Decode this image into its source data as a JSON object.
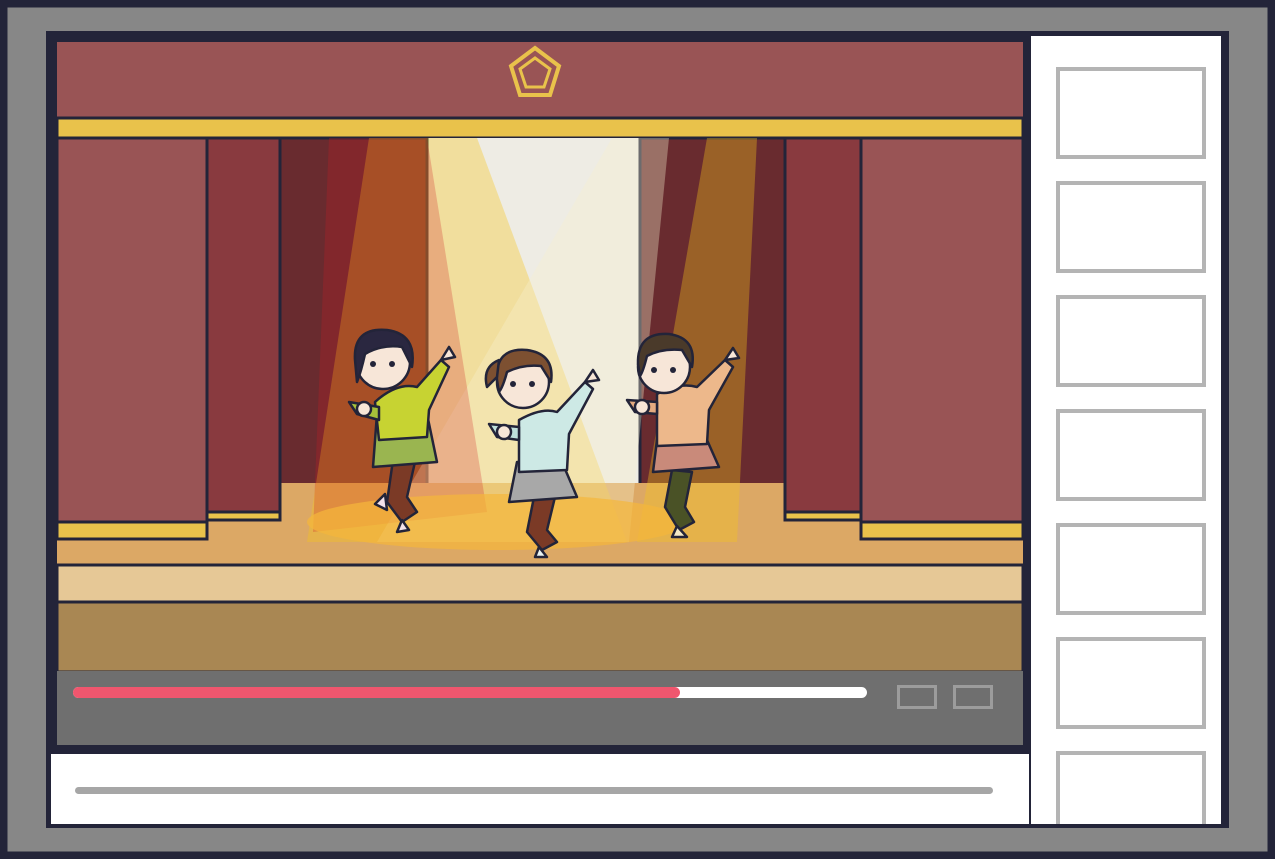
{
  "theme": {
    "frame": "#878787",
    "frame_border": "#232439",
    "accent": "#f0566e",
    "controls_bg": "#6f6f6f"
  },
  "player": {
    "scene": "stage-dance",
    "progress": 0.765
  },
  "controls": {
    "buttons": [
      {
        "icon": "settings-icon"
      },
      {
        "icon": "fullscreen-icon"
      }
    ]
  },
  "sidebar": {
    "thumbnails": 7
  }
}
